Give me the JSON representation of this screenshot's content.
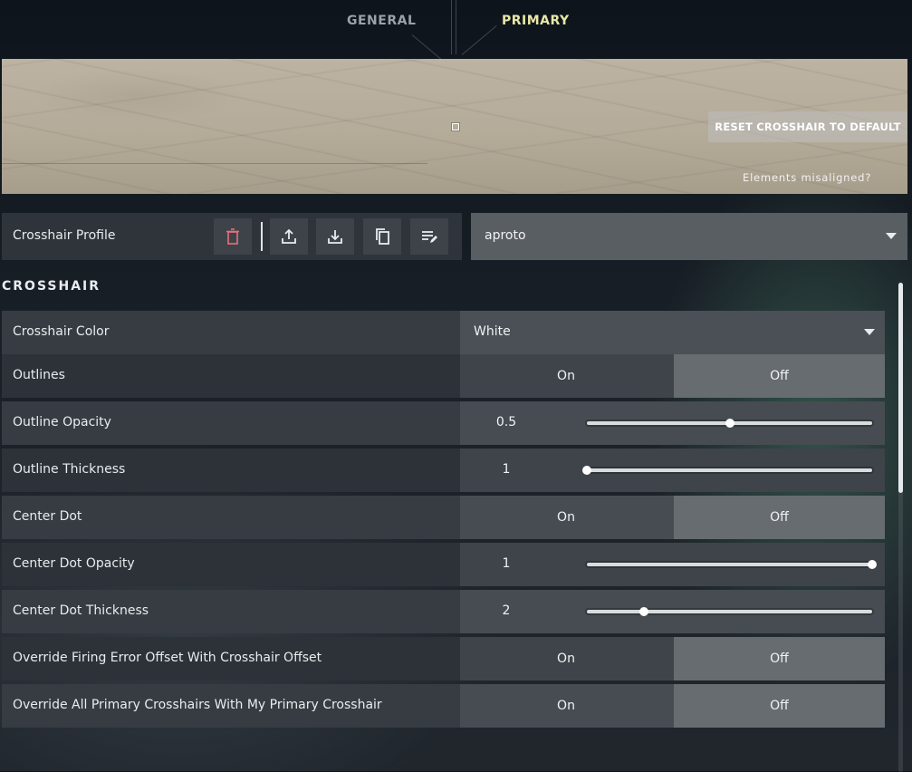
{
  "tabs": [
    {
      "label": "GENERAL",
      "active": false
    },
    {
      "label": "PRIMARY",
      "active": true
    }
  ],
  "preview": {
    "reset_label": "RESET CROSSHAIR TO DEFAULT",
    "misaligned_label": "Elements misaligned?"
  },
  "profile": {
    "label": "Crosshair Profile",
    "selected": "aproto",
    "icons": [
      "trash-icon",
      "upload-icon",
      "download-icon",
      "copy-icon",
      "edit-list-icon"
    ]
  },
  "crosshair": {
    "section_title": "CROSSHAIR",
    "color": {
      "label": "Crosshair Color",
      "value": "White"
    },
    "outlines": {
      "label": "Outlines",
      "on": "On",
      "off": "Off",
      "selected": "Off"
    },
    "outline_opacity": {
      "label": "Outline Opacity",
      "value": "0.5",
      "fraction": 0.5
    },
    "outline_thickness": {
      "label": "Outline Thickness",
      "value": "1",
      "fraction": 0.0
    },
    "center_dot": {
      "label": "Center Dot",
      "on": "On",
      "off": "Off",
      "selected": "Off"
    },
    "center_dot_opacity": {
      "label": "Center Dot Opacity",
      "value": "1",
      "fraction": 1.0
    },
    "center_dot_thickness": {
      "label": "Center Dot Thickness",
      "value": "2",
      "fraction": 0.2
    },
    "override_firing_error": {
      "label": "Override Firing Error Offset With Crosshair Offset",
      "on": "On",
      "off": "Off",
      "selected": "Off"
    },
    "override_all_primary": {
      "label": "Override All Primary Crosshairs With My Primary Crosshair",
      "on": "On",
      "off": "Off",
      "selected": "Off"
    }
  },
  "colors": {
    "accent_tab": "#e9e7a8",
    "trash_icon": "#e8707a"
  }
}
